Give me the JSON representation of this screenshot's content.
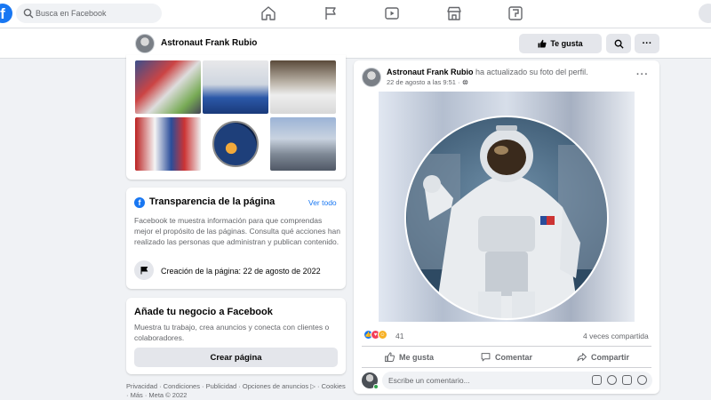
{
  "topbar": {
    "logo": "f",
    "search_placeholder": "Busca en Facebook",
    "nav_icons": [
      "home-icon",
      "flag-icon",
      "video-icon",
      "marketplace-icon",
      "gaming-icon"
    ]
  },
  "page_header": {
    "name": "Astronaut Frank Rubio",
    "like_label": "Te gusta",
    "more_label": "···"
  },
  "transparency": {
    "title": "Transparencia de la página",
    "see_all": "Ver todo",
    "description": "Facebook te muestra información para que comprendas mejor el propósito de las páginas. Consulta qué acciones han realizado las personas que administran y publican contenido.",
    "creation": "Creación de la página: 22 de agosto de 2022"
  },
  "business": {
    "title": "Añade tu negocio a Facebook",
    "description": "Muestra tu trabajo, crea anuncios y conecta con clientes o colaboradores.",
    "button": "Crear página"
  },
  "footer": {
    "links": "Privacidad · Condiciones · Publicidad · Opciones de anuncios ▷ · Cookies · Más · Meta © 2022"
  },
  "post": {
    "author": "Astronaut Frank Rubio",
    "action": "ha actualizado su foto del perfil.",
    "timestamp": "22 de agosto a las 9:51 ·",
    "more": "···",
    "reaction_count": "41",
    "shares": "4 veces compartida",
    "actions": {
      "like": "Me gusta",
      "comment": "Comentar",
      "share": "Compartir"
    },
    "comment_placeholder": "Escribe un comentario..."
  },
  "colors": {
    "brand": "#1877f2",
    "background": "#f0f2f5",
    "secondary_text": "#65676b"
  }
}
